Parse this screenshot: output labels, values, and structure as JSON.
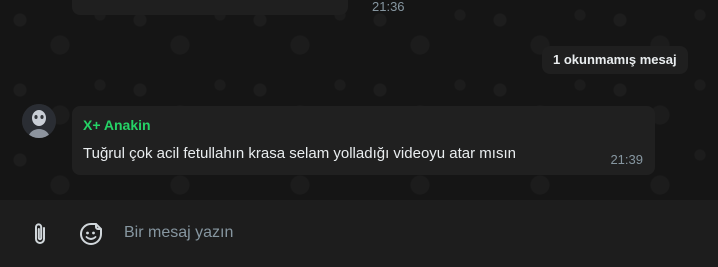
{
  "previous_message": {
    "time": "21:36"
  },
  "unread_banner": {
    "text": "1 okunmamış mesaj"
  },
  "message": {
    "sender": "X+ Anakin",
    "text": "Tuğrul çok acil fetullahın krasa selam yolladığı videoyu atar mısın",
    "time": "21:39"
  },
  "composer": {
    "placeholder": "Bir mesaj yazın",
    "attach_icon": "paperclip-icon",
    "sticker_icon": "sticker-icon"
  },
  "colors": {
    "sender": "#25d366",
    "bubble": "#202020",
    "timestamp": "#8696a0",
    "background": "#121212"
  }
}
